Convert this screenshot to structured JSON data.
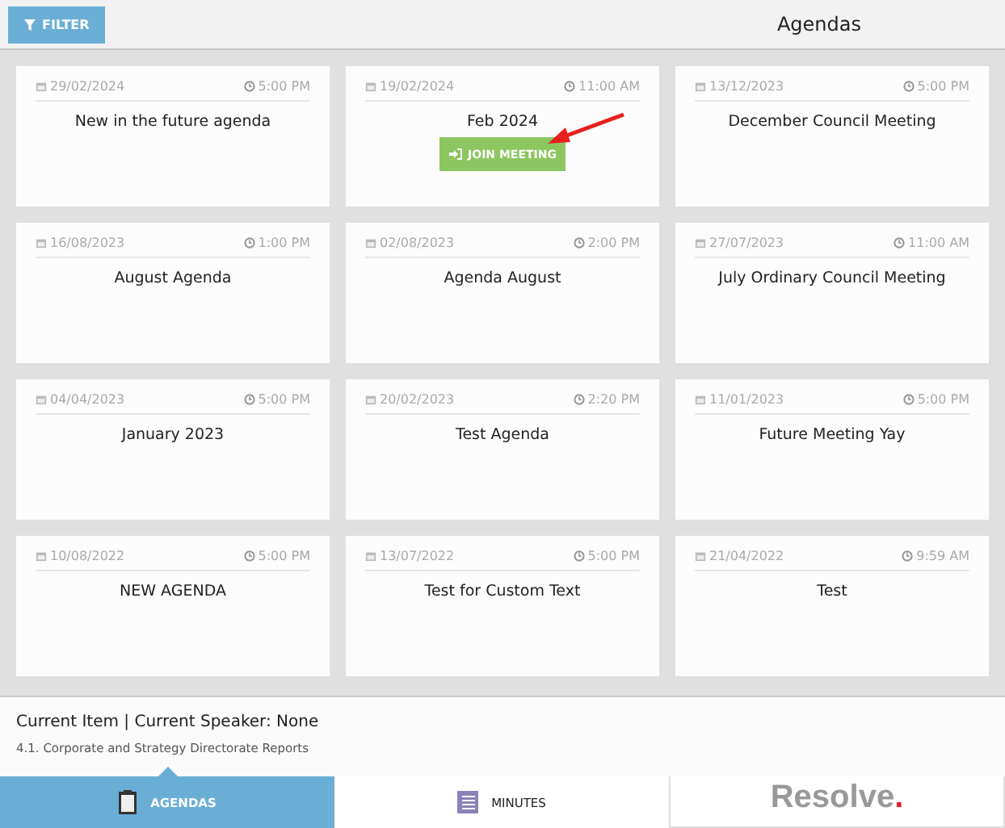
{
  "toolbar": {
    "filter_button": "FILTER",
    "title": "Agendas"
  },
  "agendas": [
    {
      "date": "29/02/2024",
      "time": "5:00 PM",
      "title": "New in the future agenda"
    },
    {
      "date": "19/02/2024",
      "time": "11:00 AM",
      "title": "Feb 2024",
      "join_button": "JOIN MEETING",
      "annotated": true
    },
    {
      "date": "13/12/2023",
      "time": "5:00 PM",
      "title": "December Council Meeting"
    },
    {
      "date": "16/08/2023",
      "time": "1:00 PM",
      "title": "August Agenda"
    },
    {
      "date": "02/08/2023",
      "time": "2:00 PM",
      "title": "Agenda August"
    },
    {
      "date": "27/07/2023",
      "time": "11:00 AM",
      "title": "July Ordinary Council Meeting"
    },
    {
      "date": "04/04/2023",
      "time": "5:00 PM",
      "title": "January 2023"
    },
    {
      "date": "20/02/2023",
      "time": "2:20 PM",
      "title": "Test Agenda"
    },
    {
      "date": "11/01/2023",
      "time": "5:00 PM",
      "title": "Future Meeting Yay"
    },
    {
      "date": "10/08/2022",
      "time": "5:00 PM",
      "title": "NEW AGENDA"
    },
    {
      "date": "13/07/2022",
      "time": "5:00 PM",
      "title": "Test for Custom Text"
    },
    {
      "date": "21/04/2022",
      "time": "9:59 AM",
      "title": "Test"
    }
  ],
  "current": {
    "heading": "Current Item | Current Speaker: None",
    "item": "4.1. Corporate and Strategy Directorate Reports"
  },
  "tabs": [
    {
      "label": "AGENDAS",
      "kind": "agendas",
      "selected": true
    },
    {
      "label": "MINUTES",
      "kind": "minutes",
      "selected": false
    }
  ],
  "logo": {
    "text": "Resolve",
    "dot": "."
  }
}
